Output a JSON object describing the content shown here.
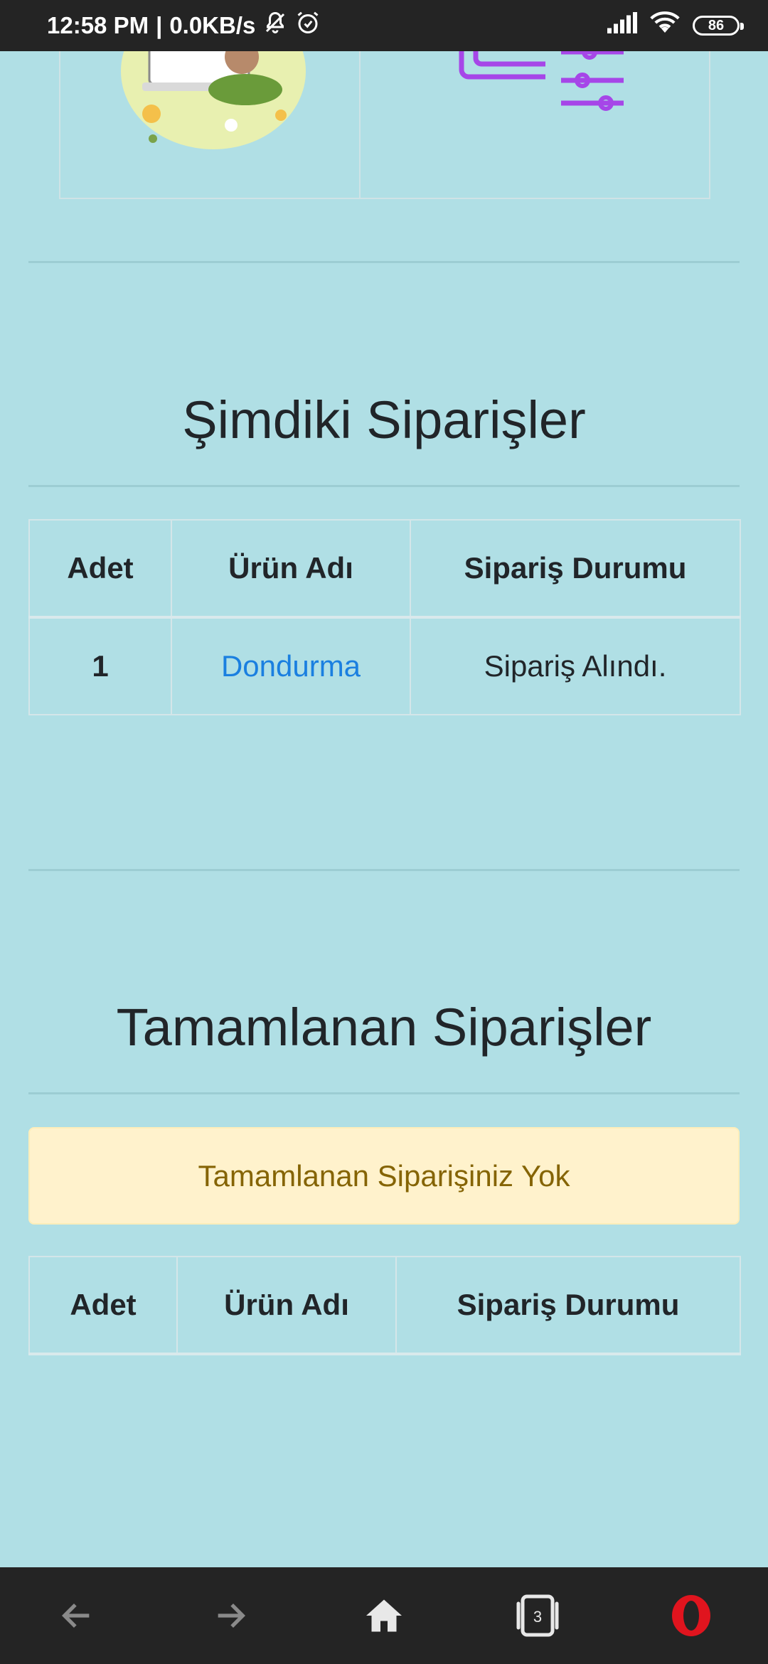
{
  "status_bar": {
    "time": "12:58 PM",
    "network_speed": "0.0KB/s",
    "battery": "86",
    "icons": [
      "muted-bell-icon",
      "alarm-icon",
      "signal-icon",
      "wifi-icon",
      "battery-icon"
    ]
  },
  "top_cards": {
    "left_image": "person-laptop-illustration",
    "right_image": "settings-sliders-icon"
  },
  "current_orders": {
    "title": "Şimdiki Siparişler",
    "headers": {
      "qty": "Adet",
      "product": "Ürün Adı",
      "status": "Sipariş Durumu"
    },
    "rows": [
      {
        "qty": "1",
        "product": "Dondurma",
        "status": "Sipariş Alındı."
      }
    ]
  },
  "completed_orders": {
    "title": "Tamamlanan Siparişler",
    "alert": "Tamamlanan Siparişiniz Yok",
    "headers": {
      "qty": "Adet",
      "product": "Ürün Adı",
      "status": "Sipariş Durumu"
    }
  },
  "bottom_nav": {
    "tab_count": "3",
    "icons": [
      "back-arrow-icon",
      "forward-arrow-icon",
      "home-icon",
      "tabs-icon",
      "opera-icon"
    ]
  },
  "colors": {
    "background": "#b0dfe5",
    "link": "#1a7fe0",
    "alert_bg": "#fff2cc",
    "alert_text": "#856404",
    "bar": "#242424"
  }
}
